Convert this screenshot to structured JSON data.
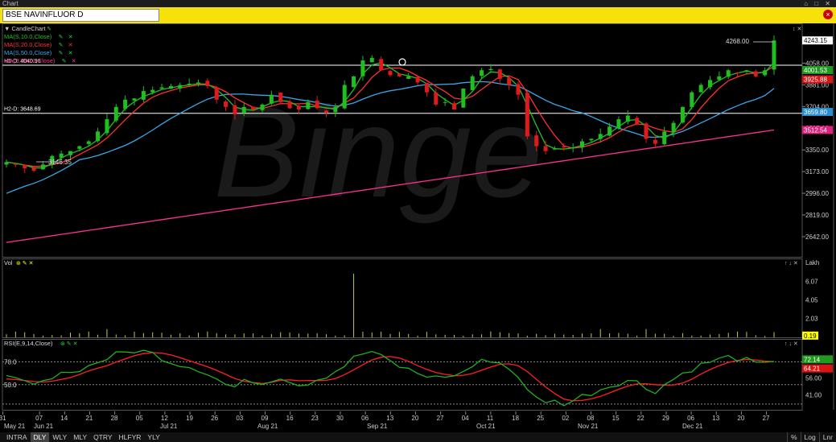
{
  "window": {
    "title": "Chart",
    "controls": "⌂ □ ✕"
  },
  "symbol": {
    "value": "BSE NAVINFLUOR D",
    "close_icon": "close-icon"
  },
  "watermark": "Binge",
  "price_panel": {
    "legend": [
      {
        "label": "CandleChart",
        "color": "#cfcfcf"
      },
      {
        "label": "MA(S,10.0,Close)",
        "color": "#22c022"
      },
      {
        "label": "MA(S,20.0,Close)",
        "color": "#ff3030"
      },
      {
        "label": "MA(S,50.0,Close)",
        "color": "#38a8e8"
      },
      {
        "label": "MA(S,200.0,Close)",
        "color": "#ff3090"
      }
    ],
    "h1_label": "H1-D: 4040.96",
    "h2_label": "H2-D: 3648.69",
    "low_label": "3146.35",
    "high_label": "4268.00",
    "ylim": [
      2530,
      4330
    ],
    "y_ticks": [
      4058.0,
      3881.0,
      3704.0,
      3527.0,
      3350.0,
      3173.0,
      2996.0,
      2819.0,
      2642.0
    ],
    "y_tick_labels": [
      "4058.00",
      "3881.00",
      "3704.00",
      "3527.00",
      "3350.00",
      "3173.00",
      "2996.00",
      "2819.00",
      "2642.00"
    ],
    "value_tags": [
      {
        "text": "4243.15",
        "value": 4243.15,
        "bg": "#ffffff",
        "fg": "#000000"
      },
      {
        "text": "4001.53",
        "value": 4001.53,
        "bg": "#1f9a1f",
        "fg": "#ffffff"
      },
      {
        "text": "3925.88",
        "value": 3925.88,
        "bg": "#d81414",
        "fg": "#ffffff"
      },
      {
        "text": "3659.80",
        "value": 3659.8,
        "bg": "#2a8fd0",
        "fg": "#ffffff"
      },
      {
        "text": "3512.54",
        "value": 3512.54,
        "bg": "#e0207a",
        "fg": "#ffffff"
      }
    ],
    "h1_value": 4040.96,
    "h2_value": 3648.69
  },
  "volume_panel": {
    "title": "Vol",
    "unit": "Lakh",
    "ylim": [
      0,
      8.2
    ],
    "y_ticks": [
      6.07,
      4.05,
      2.03
    ],
    "y_tick_labels": [
      "6.07",
      "4.05",
      "2.03"
    ],
    "tag": {
      "text": "0.19",
      "value": 0.19
    }
  },
  "rsi_panel": {
    "title": "RSI(E,9,14,Close)",
    "ylim": [
      28,
      90
    ],
    "levels": [
      70,
      50
    ],
    "level_labels": [
      "70.0",
      "50.0"
    ],
    "y_ticks": [
      56.0,
      41.0
    ],
    "y_tick_labels": [
      "56.00",
      "41.00"
    ],
    "tags": [
      {
        "text": "72.14",
        "value": 72.14,
        "bg": "#1f9a1f"
      },
      {
        "text": "64.21",
        "value": 64.21,
        "bg": "#d81414"
      }
    ]
  },
  "x_axis": {
    "days": [
      "31",
      "07",
      "14",
      "21",
      "28",
      "05",
      "12",
      "19",
      "26",
      "03",
      "09",
      "16",
      "23",
      "30",
      "06",
      "13",
      "20",
      "27",
      "04",
      "11",
      "18",
      "25",
      "02",
      "08",
      "15",
      "22",
      "29",
      "06",
      "13",
      "20",
      "27"
    ],
    "months": [
      "May 21",
      "Jun 21",
      "Jul 21",
      "Aug 21",
      "Sep 21",
      "Oct 21",
      "Nov 21",
      "Dec 21"
    ]
  },
  "bottom_tabs": [
    "INTRA",
    "DLY",
    "WLY",
    "MLY",
    "QTRY",
    "HLFYR",
    "YLY"
  ],
  "active_tab": "DLY",
  "right_tabs": [
    "%",
    "Log",
    "Lnr"
  ],
  "chart_data": {
    "type": "candlestick",
    "title": "BSE NAVINFLUOR D",
    "period": "Daily, May 2021 – Dec 2021",
    "close_anchors": [
      3250,
      3230,
      3200,
      3180,
      3230,
      3300,
      3320,
      3340,
      3380,
      3420,
      3500,
      3600,
      3700,
      3760,
      3770,
      3830,
      3840,
      3860,
      3870,
      3880,
      3890,
      3900,
      3870,
      3760,
      3700,
      3640,
      3700,
      3680,
      3720,
      3800,
      3740,
      3690,
      3680,
      3740,
      3690,
      3650,
      3700,
      3880,
      3950,
      4080,
      4100,
      4000,
      3960,
      3950,
      3950,
      3900,
      3820,
      3720,
      3740,
      3680,
      3850,
      3950,
      4000,
      4010,
      3930,
      3880,
      3800,
      3460,
      3380,
      3340,
      3360,
      3370,
      3370,
      3420,
      3440,
      3480,
      3540,
      3600,
      3630,
      3560,
      3440,
      3400,
      3500,
      3570,
      3700,
      3820,
      3880,
      3920,
      3950,
      4000,
      3980,
      4000,
      3950,
      4000,
      4243
    ],
    "volume_note": "spike on 09 Aug ~6.9 Lakh",
    "ma_labels": [
      "MA(S,10.0,Close)",
      "MA(S,20.0,Close)",
      "MA(S,50.0,Close)",
      "MA(S,200.0,Close)"
    ],
    "rsi_anchors": [
      55,
      54,
      52,
      50,
      51,
      58,
      62,
      60,
      64,
      66,
      70,
      73,
      76,
      78,
      80,
      79,
      77,
      74,
      70,
      68,
      66,
      64,
      60,
      55,
      50,
      48,
      52,
      54,
      51,
      55,
      57,
      54,
      50,
      52,
      55,
      58,
      62,
      67,
      73,
      77,
      79,
      74,
      70,
      66,
      63,
      60,
      58,
      56,
      58,
      57,
      62,
      66,
      70,
      72,
      69,
      64,
      58,
      44,
      38,
      36,
      35,
      34,
      36,
      40,
      43,
      46,
      49,
      52,
      54,
      52,
      47,
      45,
      50,
      55,
      60,
      64,
      67,
      70,
      72,
      74,
      73,
      71,
      68,
      67,
      72
    ]
  }
}
